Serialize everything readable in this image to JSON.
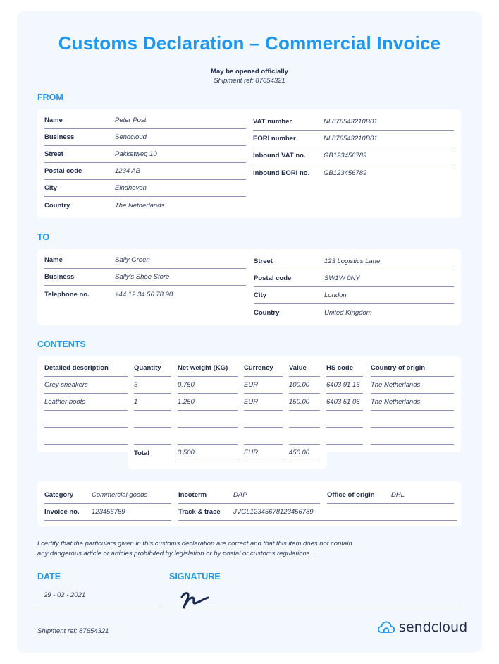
{
  "header": {
    "title": "Customs Declaration – Commercial Invoice",
    "notice": "May be opened officially",
    "shipment_ref": "Shipment ref: 87654321"
  },
  "from": {
    "heading": "FROM",
    "left": [
      {
        "label": "Name",
        "value": "Peter Post"
      },
      {
        "label": "Business",
        "value": "Sendcloud"
      },
      {
        "label": "Street",
        "value": "Pakketweg 10"
      },
      {
        "label": "Postal code",
        "value": "1234 AB"
      },
      {
        "label": "City",
        "value": "Eindhoven"
      },
      {
        "label": "Country",
        "value": "The Netherlands"
      }
    ],
    "right": [
      {
        "label": "VAT number",
        "value": "NL876543210B01"
      },
      {
        "label": "EORI number",
        "value": "NL876543210B01"
      },
      {
        "label": "Inbound VAT no.",
        "value": "GB123456789"
      },
      {
        "label": "Inbound EORI no.",
        "value": "GB123456789"
      }
    ]
  },
  "to": {
    "heading": "TO",
    "left": [
      {
        "label": "Name",
        "value": "Sally Green"
      },
      {
        "label": "Business",
        "value": "Sally's Shoe Store"
      },
      {
        "label": "Telephone no.",
        "value": "+44 12 34 56 78 90"
      }
    ],
    "right": [
      {
        "label": "Street",
        "value": "123 Logistics Lane"
      },
      {
        "label": "Postal code",
        "value": "SW1W 0NY"
      },
      {
        "label": "City",
        "value": "London"
      },
      {
        "label": "Country",
        "value": "United Kingdom"
      }
    ]
  },
  "contents": {
    "heading": "CONTENTS",
    "columns": [
      "Detailed description",
      "Quantity",
      "Net weight (KG)",
      "Currency",
      "Value",
      "HS code",
      "Country of origin"
    ],
    "rows": [
      [
        "Grey sneakers",
        "3",
        "0.750",
        "EUR",
        "100.00",
        "6403 91 16",
        "The Netherlands"
      ],
      [
        "Leather boots",
        "1",
        "1.250",
        "EUR",
        "150.00",
        "6403 51 05",
        "The Netherlands"
      ],
      [
        "",
        "",
        "",
        "",
        "",
        "",
        ""
      ],
      [
        "",
        "",
        "",
        "",
        "",
        "",
        ""
      ]
    ],
    "total": {
      "label": "Total",
      "weight": "3.500",
      "currency": "EUR",
      "value": "450.00"
    }
  },
  "details": {
    "category_label": "Category",
    "category_value": "Commercial goods",
    "incoterm_label": "Incoterm",
    "incoterm_value": "DAP",
    "office_label": "Office of origin",
    "office_value": "DHL",
    "invoice_label": "Invoice no.",
    "invoice_value": "123456789",
    "track_label": "Track & trace",
    "track_value": "JVGL12345678123456789"
  },
  "certification": {
    "line1": "I certify that the particulars given in this customs declaration are correct and that this item does not contain",
    "line2": "any dangerous article or articles prohibited by legislation or by postal or customs regulations."
  },
  "signoff": {
    "date_heading": "DATE",
    "date_value": "29 - 02 - 2021",
    "signature_heading": "SIGNATURE"
  },
  "footer": {
    "shipment_ref": "Shipment ref: 87654321",
    "brand": "sendcloud"
  },
  "colors": {
    "accent": "#1c98f3",
    "text": "#1f2b4d",
    "page_bg": "#f3f8fe",
    "card_bg": "#ffffff",
    "rule": "#8b96b6"
  }
}
